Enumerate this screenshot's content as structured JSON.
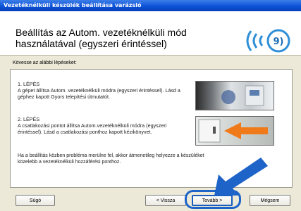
{
  "window": {
    "title": "Vezetéknélküli készülék beállítása varázsló"
  },
  "header": {
    "title_line1": "Beállítás az Autom. vezetéknélküli mód",
    "title_line2": "használatával (egyszeri érintéssel)"
  },
  "instructions": "Kövesse az alábbi lépéseket:",
  "steps": [
    {
      "title": "1. LÉPÉS",
      "text": "A gépet állítsa Autom. vezetéknélküli módra (egyszeri érintéssel). Lásd a géphez kapott Gyors telepítési útmutatót."
    },
    {
      "title": "2. LÉPÉS",
      "text": "A csatlakozási pontot állítsa Autom.vezetéknélküli módra (egyszeri érintéssel). Lásd a csatlakozási ponthoz kapott kézikönyvet."
    }
  ],
  "note": "Ha a beállítás közben probléma merülne fel, akkor átmenetileg helyezze a készüléket közelebb a vezetéknélküli hozzáférési ponthoz.",
  "buttons": {
    "help": "Súgó",
    "back": "< Vissza",
    "next": "Tovább >",
    "cancel": "Mégsem"
  },
  "colors": {
    "titlebar": "#0a4fd6",
    "accent": "#1e64c8",
    "arrow": "#f07a1a"
  }
}
